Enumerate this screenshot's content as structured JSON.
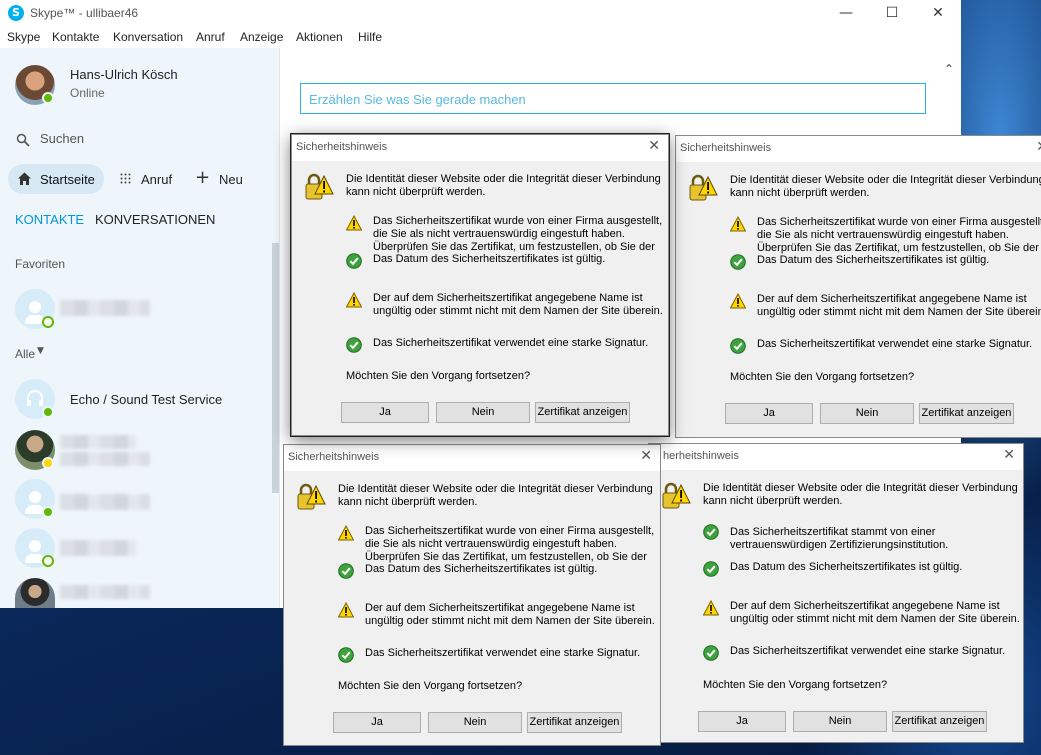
{
  "window": {
    "title": "Skype™ - ullibaer46",
    "logo": "S",
    "min": "—",
    "max": "☐",
    "close": "✕"
  },
  "menu": [
    "Skype",
    "Kontakte",
    "Konversation",
    "Anruf",
    "Anzeige",
    "Aktionen",
    "Hilfe"
  ],
  "profile": {
    "name": "Hans-Ulrich Kösch",
    "status": "Online"
  },
  "search": {
    "label": "Suchen"
  },
  "nav": {
    "home": "Startseite",
    "call": "Anruf",
    "new": "Neu"
  },
  "tabs": {
    "contacts": "KONTAKTE",
    "conversations": "KONVERSATIONEN"
  },
  "sections": {
    "favorites": "Favoriten",
    "all": "Alle"
  },
  "contacts": {
    "echo": "Echo / Sound Test Service"
  },
  "mood": {
    "placeholder": "Erzählen Sie was Sie gerade machen"
  },
  "colors": {
    "accent": "#00aff0",
    "online": "#5fb900",
    "away": "#ffd800"
  },
  "dialogs": [
    {
      "title": "Sicherheitshinweis",
      "intro1": "Die Identität dieser Website oder die Integrität dieser Verbindung",
      "intro2": "kann nicht überprüft werden.",
      "items": [
        {
          "icon": "warning",
          "lines": [
            "Das Sicherheitszertifikat wurde von einer Firma ausgestellt,",
            "die Sie als nicht vertrauenswürdig eingestuft haben.",
            "Überprüfen Sie das Zertifikat, um festzustellen, ob Sie der"
          ]
        },
        {
          "icon": "ok",
          "lines": [
            "Das Datum des Sicherheitszertifikates ist gültig."
          ]
        },
        {
          "icon": "warning",
          "lines": [
            "Der auf dem Sicherheitszertifikat angegebene Name ist",
            "ungültig oder stimmt nicht mit dem Namen der Site überein."
          ]
        },
        {
          "icon": "ok",
          "lines": [
            "Das Sicherheitszertifikat verwendet eine starke Signatur."
          ]
        }
      ],
      "question": "Möchten Sie den Vorgang fortsetzen?",
      "yes": "Ja",
      "no": "Nein",
      "view": "Zertifikat anzeigen"
    },
    {
      "title": "Sicherheitshinweis",
      "intro1": "Die Identität dieser Website oder die Integrität dieser Verbindung",
      "intro2": "kann nicht überprüft werden.",
      "items": [
        {
          "icon": "warning",
          "lines": [
            "Das Sicherheitszertifikat wurde von einer Firma ausgestellt,",
            "die Sie als nicht vertrauenswürdig eingestuft haben.",
            "Überprüfen Sie das Zertifikat, um festzustellen, ob Sie der"
          ]
        },
        {
          "icon": "ok",
          "lines": [
            "Das Datum des Sicherheitszertifikates ist gültig."
          ]
        },
        {
          "icon": "warning",
          "lines": [
            "Der auf dem Sicherheitszertifikat angegebene Name ist",
            "ungültig oder stimmt nicht mit dem Namen der Site überein."
          ]
        },
        {
          "icon": "ok",
          "lines": [
            "Das Sicherheitszertifikat verwendet eine starke Signatur."
          ]
        }
      ],
      "question": "Möchten Sie den Vorgang fortsetzen?",
      "yes": "Ja",
      "no": "Nein",
      "view": "Zertifikat anzeigen"
    },
    {
      "title": "Sicherheitshinweis",
      "intro1": "Die Identität dieser Website oder die Integrität dieser Verbindung",
      "intro2": "kann nicht überprüft werden.",
      "items": [
        {
          "icon": "warning",
          "lines": [
            "Das Sicherheitszertifikat wurde von einer Firma ausgestellt,",
            "die Sie als nicht vertrauenswürdig eingestuft haben.",
            "Überprüfen Sie das Zertifikat, um festzustellen, ob Sie der"
          ]
        },
        {
          "icon": "ok",
          "lines": [
            "Das Datum des Sicherheitszertifikates ist gültig."
          ]
        },
        {
          "icon": "warning",
          "lines": [
            "Der auf dem Sicherheitszertifikat angegebene Name ist",
            "ungültig oder stimmt nicht mit dem Namen der Site überein."
          ]
        },
        {
          "icon": "ok",
          "lines": [
            "Das Sicherheitszertifikat verwendet eine starke Signatur."
          ]
        }
      ],
      "question": "Möchten Sie den Vorgang fortsetzen?",
      "yes": "Ja",
      "no": "Nein",
      "view": "Zertifikat anzeigen"
    },
    {
      "title": "herheitshinweis",
      "intro1": "Die Identität dieser Website oder die Integrität dieser Verbindung",
      "intro2": "kann nicht überprüft werden.",
      "items": [
        {
          "icon": "ok",
          "lines": [
            "Das Sicherheitszertifikat stammt von einer",
            "vertrauenswürdigen Zertifizierungsinstitution."
          ]
        },
        {
          "icon": "ok",
          "lines": [
            "Das Datum des Sicherheitszertifikates ist gültig."
          ]
        },
        {
          "icon": "warning",
          "lines": [
            "Der auf dem Sicherheitszertifikat angegebene Name ist",
            "ungültig oder stimmt nicht mit dem Namen der Site überein."
          ]
        },
        {
          "icon": "ok",
          "lines": [
            "Das Sicherheitszertifikat verwendet eine starke Signatur."
          ]
        }
      ],
      "question": "Möchten Sie den Vorgang fortsetzen?",
      "yes": "Ja",
      "no": "Nein",
      "view": "Zertifikat anzeigen"
    }
  ]
}
